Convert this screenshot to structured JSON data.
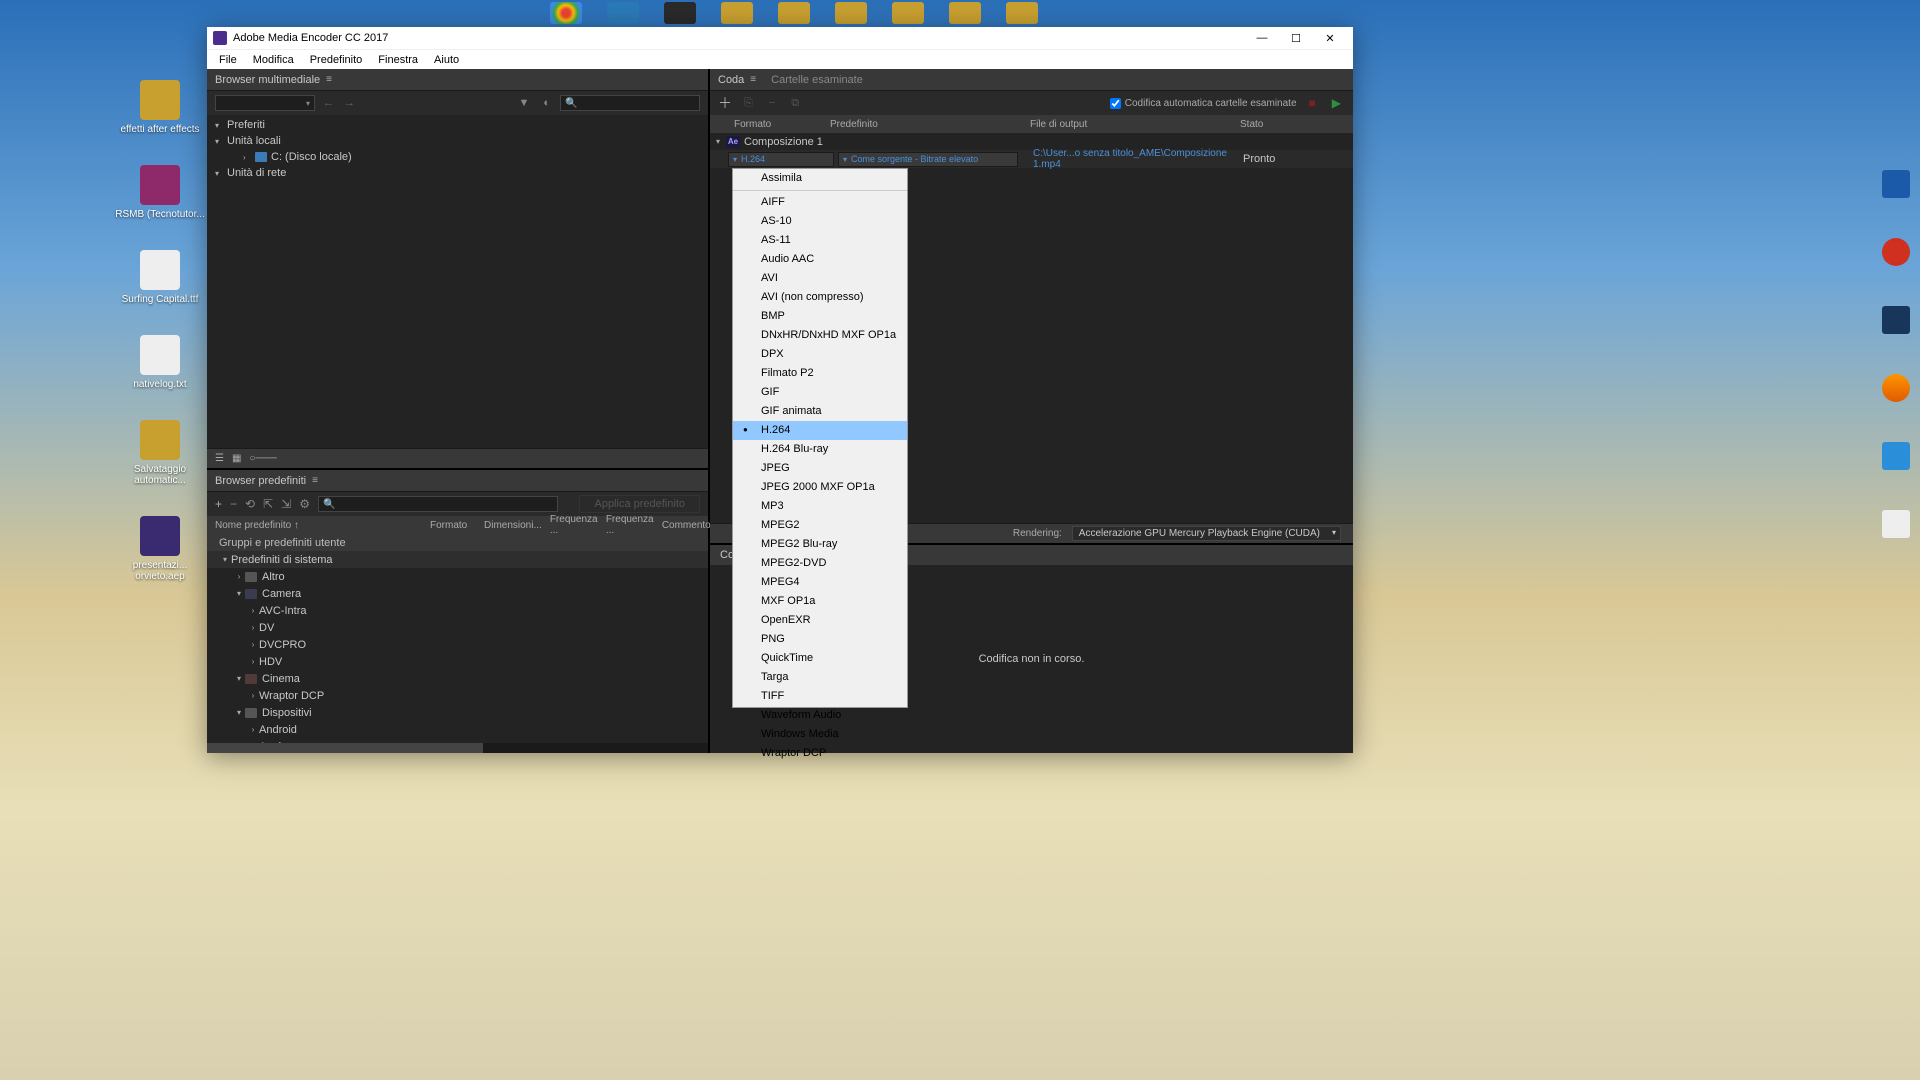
{
  "title": "Adobe Media Encoder CC 2017",
  "menus": [
    "File",
    "Modifica",
    "Predefinito",
    "Finestra",
    "Aiuto"
  ],
  "desktop_icons": [
    {
      "label": "effetti after effects",
      "color": "#c8a030"
    },
    {
      "label": "RSMB (Tecnotutor...",
      "color": "#8e2a6a"
    },
    {
      "label": "Surfing Capital.ttf",
      "color": "#eeeeee"
    },
    {
      "label": "nativelog.txt",
      "color": "#eeeeee"
    },
    {
      "label": "Salvataggio automatic...",
      "color": "#c8a030"
    },
    {
      "label": "presentazi... orvieto.aep",
      "color": "#3a2a70"
    }
  ],
  "media_browser": {
    "title": "Browser multimediale",
    "tree": {
      "favorites": "Preferiti",
      "local": "Unità locali",
      "drive": "C: (Disco locale)",
      "network": "Unità di rete"
    }
  },
  "preset_browser": {
    "title": "Browser predefiniti",
    "apply": "Applica predefinito",
    "headers": {
      "name": "Nome predefinito ↑",
      "fmt": "Formato",
      "dim": "Dimensioni...",
      "freq1": "Frequenza ...",
      "freq2": "Frequenza ...",
      "comm": "Commento"
    },
    "groups": {
      "user": "Gruppi e predefiniti utente",
      "system": "Predefiniti di sistema",
      "altro": "Altro",
      "camera": "Camera",
      "camera_items": [
        "AVC-Intra",
        "DV",
        "DVCPRO",
        "HDV"
      ],
      "cinema": "Cinema",
      "cinema_items": [
        "Wraptor DCP"
      ],
      "dispositivi": "Dispositivi",
      "disp_items": [
        "Android",
        "Apple"
      ]
    }
  },
  "queue": {
    "tabs": {
      "coda": "Coda",
      "watch": "Cartelle esaminate"
    },
    "auto": "Codifica automatica cartelle esaminate",
    "headers": {
      "fmt": "Formato",
      "preset": "Predefinito",
      "out": "File di output",
      "state": "Stato"
    },
    "comp": {
      "name": "Composizione 1"
    },
    "row": {
      "format": "H.264",
      "preset": "Come sorgente - Bitrate elevato",
      "output": "C:\\User...o senza titolo_AME\\Composizione 1.mp4",
      "state": "Pronto"
    }
  },
  "format_menu": {
    "top": "Assimila",
    "items": [
      "AIFF",
      "AS-10",
      "AS-11",
      "Audio AAC",
      "AVI",
      "AVI (non compresso)",
      "BMP",
      "DNxHR/DNxHD MXF OP1a",
      "DPX",
      "Filmato P2",
      "GIF",
      "GIF animata",
      "H.264",
      "H.264 Blu-ray",
      "JPEG",
      "JPEG 2000 MXF OP1a",
      "MP3",
      "MPEG2",
      "MPEG2 Blu-ray",
      "MPEG2-DVD",
      "MPEG4",
      "MXF OP1a",
      "OpenEXR",
      "PNG",
      "QuickTime",
      "Targa",
      "TIFF",
      "Waveform Audio",
      "Windows Media",
      "Wraptor DCP"
    ],
    "selected": "H.264"
  },
  "render": {
    "label": "Rendering:",
    "engine": "Accelerazione GPU Mercury Playback Engine (CUDA)"
  },
  "encoding": {
    "tab_prefix": "Co",
    "status": "Codifica non in corso."
  }
}
